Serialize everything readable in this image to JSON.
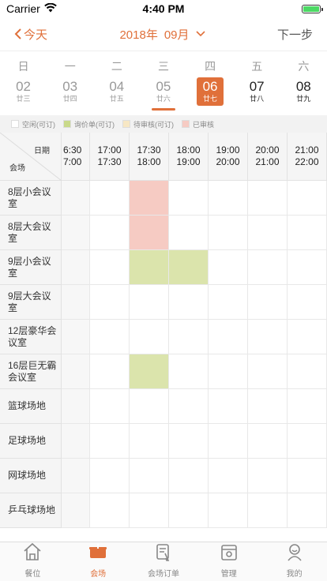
{
  "status": {
    "carrier": "Carrier",
    "time": "4:40 PM",
    "battery_level": 1.0
  },
  "nav": {
    "back_label": "今天",
    "year": "2018年",
    "month": "09月",
    "next_label": "下一步"
  },
  "week": {
    "days": [
      {
        "name": "日",
        "num": "02",
        "lunar": "廿三",
        "state": "past"
      },
      {
        "name": "一",
        "num": "03",
        "lunar": "廿四",
        "state": "past"
      },
      {
        "name": "二",
        "num": "04",
        "lunar": "廿五",
        "state": "past"
      },
      {
        "name": "三",
        "num": "05",
        "lunar": "廿六",
        "state": "past"
      },
      {
        "name": "四",
        "num": "06",
        "lunar": "廿七",
        "state": "selected"
      },
      {
        "name": "五",
        "num": "07",
        "lunar": "廿八",
        "state": "future"
      },
      {
        "name": "六",
        "num": "08",
        "lunar": "廿九",
        "state": "future"
      }
    ]
  },
  "legend": [
    {
      "label": "空闲(可订)",
      "color": "#ffffff"
    },
    {
      "label": "询价单(可订)",
      "color": "#c9d98a"
    },
    {
      "label": "待审核(可订)",
      "color": "#f7e7c4"
    },
    {
      "label": "已审核",
      "color": "#f6cbc3"
    }
  ],
  "grid": {
    "corner_date": "日期",
    "corner_venue": "会场",
    "times": [
      {
        "start": "6:30",
        "end": "7:00"
      },
      {
        "start": "17:00",
        "end": "17:30"
      },
      {
        "start": "17:30",
        "end": "18:00"
      },
      {
        "start": "18:00",
        "end": "19:00"
      },
      {
        "start": "19:00",
        "end": "20:00"
      },
      {
        "start": "20:00",
        "end": "21:00"
      },
      {
        "start": "21:00",
        "end": "22:00"
      }
    ],
    "venues": [
      {
        "name": "8层小会议室",
        "slots": [
          "free",
          "free",
          "booked",
          "free",
          "free",
          "free",
          "free"
        ]
      },
      {
        "name": "8层大会议室",
        "slots": [
          "free",
          "free",
          "booked",
          "free",
          "free",
          "free",
          "free"
        ]
      },
      {
        "name": "9层小会议室",
        "slots": [
          "free",
          "free",
          "inquiry",
          "inquiry",
          "free",
          "free",
          "free"
        ]
      },
      {
        "name": "9层大会议室",
        "slots": [
          "free",
          "free",
          "free",
          "free",
          "free",
          "free",
          "free"
        ]
      },
      {
        "name": "12层豪华会议室",
        "slots": [
          "free",
          "free",
          "free",
          "free",
          "free",
          "free",
          "free"
        ]
      },
      {
        "name": "16层巨无霸会议室",
        "slots": [
          "free",
          "free",
          "inquiry",
          "free",
          "free",
          "free",
          "free"
        ]
      },
      {
        "name": "篮球场地",
        "slots": [
          "free",
          "free",
          "free",
          "free",
          "free",
          "free",
          "free"
        ]
      },
      {
        "name": "足球场地",
        "slots": [
          "free",
          "free",
          "free",
          "free",
          "free",
          "free",
          "free"
        ]
      },
      {
        "name": "网球场地",
        "slots": [
          "free",
          "free",
          "free",
          "free",
          "free",
          "free",
          "free"
        ]
      },
      {
        "name": "乒乓球场地",
        "slots": [
          "free",
          "free",
          "free",
          "free",
          "free",
          "free",
          "free"
        ]
      }
    ]
  },
  "tabs": [
    {
      "label": "餐位",
      "icon": "home-icon",
      "active": false
    },
    {
      "label": "会场",
      "icon": "venue-icon",
      "active": true
    },
    {
      "label": "会场订单",
      "icon": "order-icon",
      "active": false
    },
    {
      "label": "管理",
      "icon": "manage-icon",
      "active": false
    },
    {
      "label": "我的",
      "icon": "profile-icon",
      "active": false
    }
  ],
  "colors": {
    "accent": "#e0703a",
    "booked": "#f6cbc3",
    "inquiry": "#dbe4ac"
  }
}
